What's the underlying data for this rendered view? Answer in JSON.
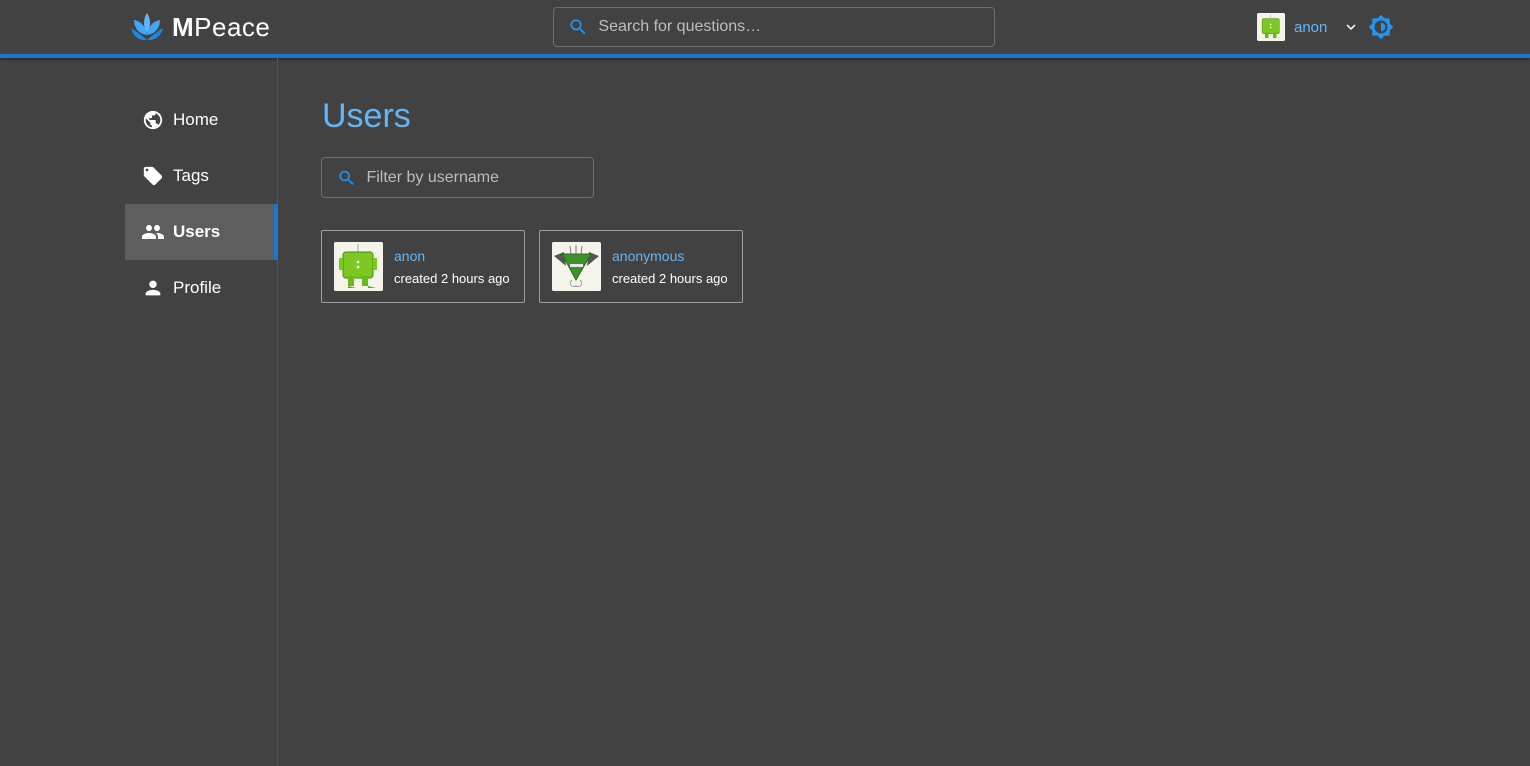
{
  "app": {
    "brand_prefix": "M",
    "brand_suffix": "Peace"
  },
  "header": {
    "search_placeholder": "Search for questions…",
    "current_user": "anon"
  },
  "sidebar": {
    "items": [
      {
        "label": "Home",
        "icon": "globe-icon"
      },
      {
        "label": "Tags",
        "icon": "tag-icon"
      },
      {
        "label": "Users",
        "icon": "people-icon",
        "active": true
      },
      {
        "label": "Profile",
        "icon": "person-icon"
      }
    ]
  },
  "main": {
    "title": "Users",
    "filter_placeholder": "Filter by username",
    "users": [
      {
        "name": "anon",
        "meta": "created 2 hours ago"
      },
      {
        "name": "anonymous",
        "meta": "created 2 hours ago"
      }
    ]
  },
  "colors": {
    "background": "#424242",
    "accent": "#1976d2",
    "link": "#64b5f6",
    "active_nav": "#5e5e5e"
  }
}
